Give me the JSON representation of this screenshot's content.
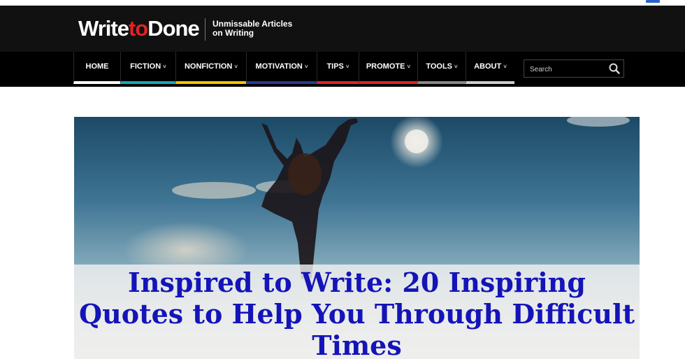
{
  "site": {
    "logo_part1": "Write",
    "logo_part2": "to",
    "logo_part3": "Done",
    "tagline_line1": "Unmissable Articles",
    "tagline_line2": "on Writing"
  },
  "nav": {
    "items": [
      {
        "label": "HOME",
        "has_dropdown": false,
        "accent": "#ffffff"
      },
      {
        "label": "FICTION",
        "has_dropdown": true,
        "accent": "#1aa7b5"
      },
      {
        "label": "NONFICTION",
        "has_dropdown": true,
        "accent": "#f2c500"
      },
      {
        "label": "MOTIVATION",
        "has_dropdown": true,
        "accent": "#2a3a8f"
      },
      {
        "label": "TIPS",
        "has_dropdown": true,
        "accent": "#e02424"
      },
      {
        "label": "PROMOTE",
        "has_dropdown": true,
        "accent": "#e02424"
      },
      {
        "label": "TOOLS",
        "has_dropdown": true,
        "accent": "#888888"
      },
      {
        "label": "ABOUT",
        "has_dropdown": true,
        "accent": "#cccccc"
      }
    ],
    "search_placeholder": "Search",
    "search_icon": "search-icon"
  },
  "article": {
    "title": "Inspired to Write: 20 Inspiring Quotes to Help You Through Difficult Times"
  },
  "colors": {
    "header_bg": "#111111",
    "nav_bg": "#000000",
    "logo_accent": "#e02424",
    "title_color": "#1414b8"
  }
}
